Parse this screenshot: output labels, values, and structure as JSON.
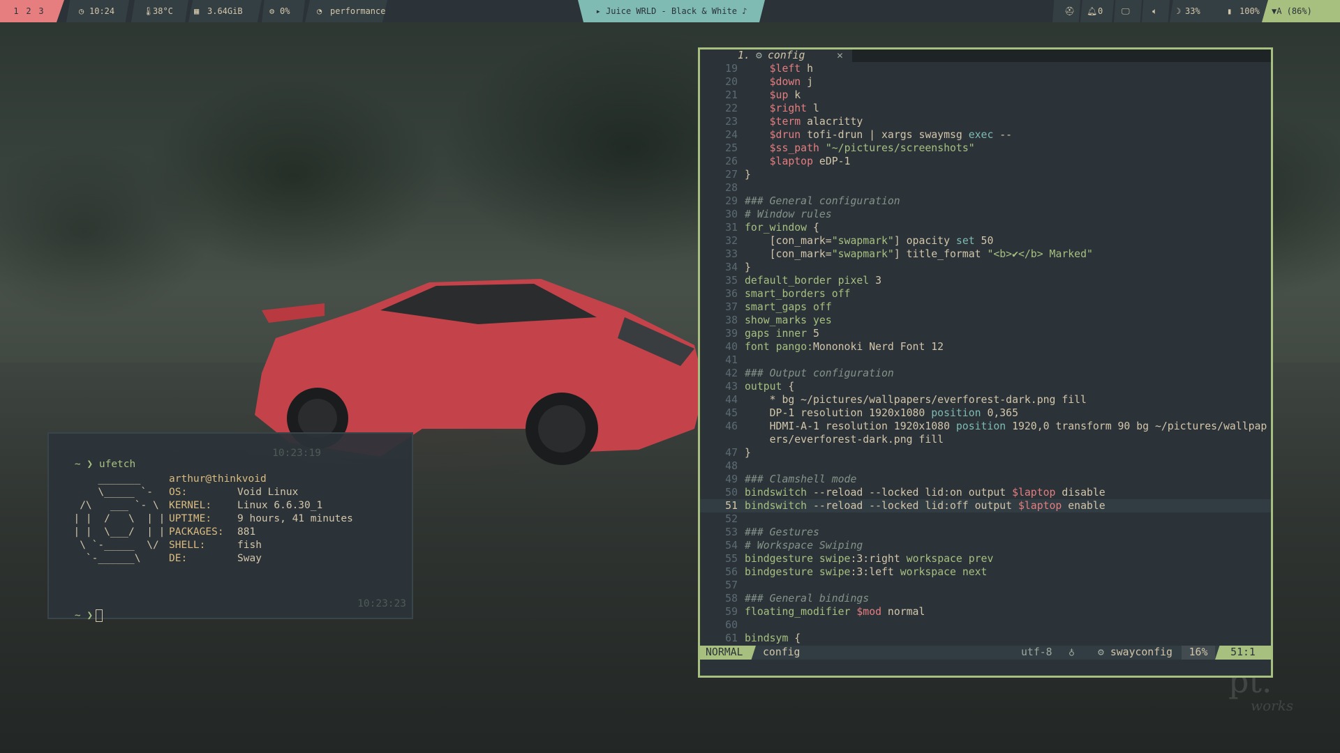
{
  "topbar": {
    "workspaces": [
      "1",
      "2",
      "3"
    ],
    "clock": "10:24",
    "temperature": "38°C",
    "memory": "3.64GiB",
    "cpu": "0%",
    "power_profile": "performance",
    "now_playing": "▸ Juice WRLD - Black & White ♪",
    "idle": "",
    "notifications": "0",
    "volume": "",
    "brightness": "33%",
    "battery": "100%",
    "wifi": "A (86%)",
    "colors": {
      "workspace_bg": "#e67e80",
      "music_bg": "#7fbbb3",
      "wifi_bg": "#a7c080",
      "bar_bg": "#2b3339"
    }
  },
  "terminal": {
    "prompt": "~ ❯",
    "command": "ufetch",
    "command_time": "10:23:19",
    "logo": "      _______\n      \\_____ `-\n   /\\   ___ `- \\\n  | |  /   \\  | |\n  | |  \\___/  | |\n   \\ `-_____  \\/\n    `-______\\",
    "user_host": "arthur@thinkvoid",
    "info": [
      {
        "key": "OS:",
        "value": "Void Linux"
      },
      {
        "key": "KERNEL:",
        "value": "Linux 6.6.30_1"
      },
      {
        "key": "UPTIME:",
        "value": "9 hours, 41 minutes"
      },
      {
        "key": "PACKAGES:",
        "value": "881"
      },
      {
        "key": "SHELL:",
        "value": "fish"
      },
      {
        "key": "DE:",
        "value": "Sway"
      }
    ],
    "second_prompt_time": "10:23:23"
  },
  "editor": {
    "tab": {
      "number": "1.",
      "name": "config",
      "close": "✕"
    },
    "status": {
      "mode": "NORMAL",
      "file": "config",
      "encoding": "utf-8",
      "filetype": "swayconfig",
      "percent": "16%",
      "position": "51:1"
    },
    "lines": [
      {
        "n": "19",
        "html": "    <span class='var'>$left</span> h"
      },
      {
        "n": "20",
        "html": "    <span class='var'>$down</span> j"
      },
      {
        "n": "21",
        "html": "    <span class='var'>$up</span> k"
      },
      {
        "n": "22",
        "html": "    <span class='var'>$right</span> l"
      },
      {
        "n": "23",
        "html": "    <span class='var'>$term</span> alacritty"
      },
      {
        "n": "24",
        "html": "    <span class='var'>$drun</span> tofi-drun | xargs swaymsg <span class='pl'>exec</span> --"
      },
      {
        "n": "25",
        "html": "    <span class='var'>$ss_path</span> <span class='str'>\"~/pictures/screenshots\"</span>"
      },
      {
        "n": "26",
        "html": "    <span class='var'>$laptop</span> eDP-1"
      },
      {
        "n": "27",
        "html": "}"
      },
      {
        "n": "28",
        "html": ""
      },
      {
        "n": "29",
        "html": "<span class='cmt'>### General configuration</span>"
      },
      {
        "n": "30",
        "html": "<span class='cmt'># Window rules</span>"
      },
      {
        "n": "31",
        "html": "<span class='kw'>for_window</span> {"
      },
      {
        "n": "32",
        "html": "    [con_mark=<span class='str'>\"swapmark\"</span>] opacity <span class='pl'>set</span> 50"
      },
      {
        "n": "33",
        "html": "    [con_mark=<span class='str'>\"swapmark\"</span>] title_format <span class='str'>\"&lt;b&gt;✔&lt;/b&gt; Marked\"</span>"
      },
      {
        "n": "34",
        "html": "}"
      },
      {
        "n": "35",
        "html": "<span class='kw'>default_border</span> <span class='grn'>pixel</span> 3"
      },
      {
        "n": "36",
        "html": "<span class='kw'>smart_borders</span> <span class='grn'>off</span>"
      },
      {
        "n": "37",
        "html": "<span class='kw'>smart_gaps</span> <span class='grn'>off</span>"
      },
      {
        "n": "38",
        "html": "<span class='kw'>show_marks</span> <span class='grn'>yes</span>"
      },
      {
        "n": "39",
        "html": "<span class='kw'>gaps</span> <span class='grn'>inner</span> 5"
      },
      {
        "n": "40",
        "html": "<span class='kw'>font</span> <span class='grn'>pango:</span>Mononoki Nerd Font 12"
      },
      {
        "n": "41",
        "html": ""
      },
      {
        "n": "42",
        "html": "<span class='cmt'>### Output configuration</span>"
      },
      {
        "n": "43",
        "html": "<span class='kw'>output</span> {"
      },
      {
        "n": "44",
        "html": "    * bg ~/pictures/wallpapers/everforest-dark.png fill"
      },
      {
        "n": "45",
        "html": "    DP-1 resolution 1920x1080 <span class='pl'>position</span> 0,365"
      },
      {
        "n": "46",
        "html": "    HDMI-A-1 resolution 1920x1080 <span class='pl'>position</span> 1920,0 transform 90 bg ~/pictures/wallpap"
      },
      {
        "n": "",
        "html": "    ers/everforest-dark.png fill"
      },
      {
        "n": "47",
        "html": "}"
      },
      {
        "n": "48",
        "html": ""
      },
      {
        "n": "49",
        "html": "<span class='cmt'>### Clamshell mode</span>"
      },
      {
        "n": "50",
        "html": "<span class='kw'>bindswitch</span> --reload --locked lid:on output <span class='var'>$laptop</span> disable"
      },
      {
        "n": "51",
        "html": "<span class='kw'>bindswitch</span> --reload --locked lid:off output <span class='var'>$laptop</span> enable",
        "current": true
      },
      {
        "n": "52",
        "html": ""
      },
      {
        "n": "53",
        "html": "<span class='cmt'>### Gestures</span>"
      },
      {
        "n": "54",
        "html": "<span class='cmt'># Workspace Swiping</span>"
      },
      {
        "n": "55",
        "html": "<span class='kw'>bindgesture</span> <span class='grn'>swipe</span>:3:right <span class='grn'>workspace prev</span>"
      },
      {
        "n": "56",
        "html": "<span class='kw'>bindgesture</span> <span class='grn'>swipe</span>:3:left <span class='grn'>workspace next</span>"
      },
      {
        "n": "57",
        "html": ""
      },
      {
        "n": "58",
        "html": "<span class='cmt'>### General bindings</span>"
      },
      {
        "n": "59",
        "html": "<span class='kw'>floating_modifier</span> <span class='var'>$mod</span> normal"
      },
      {
        "n": "60",
        "html": ""
      },
      {
        "n": "61",
        "html": "<span class='kw'>bindsym</span> {"
      }
    ]
  },
  "wallpaper": {
    "watermark": "pt.",
    "watermark_sub": "works"
  }
}
